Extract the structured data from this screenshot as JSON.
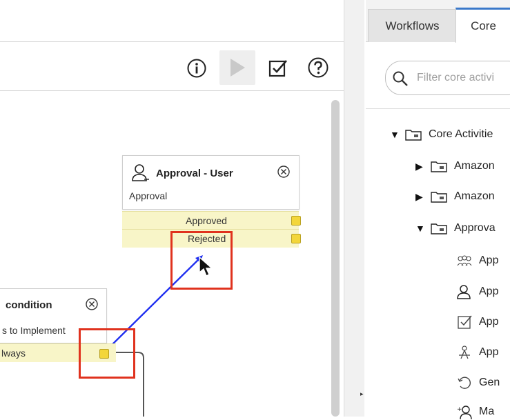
{
  "toolbar": {
    "info_icon": "info-icon",
    "run_icon": "play-icon",
    "validate_icon": "checkbox-icon",
    "help_icon": "help-icon"
  },
  "canvas": {
    "approval_activity": {
      "title": "Approval - User",
      "subtitle": "Approval",
      "exits": [
        "Approved",
        "Rejected"
      ]
    },
    "condition_activity": {
      "title": "condition",
      "subtitle": "s to Implement",
      "exit": "lways"
    }
  },
  "right_panel": {
    "tabs": [
      {
        "label": "Workflows",
        "active": false
      },
      {
        "label": "Core",
        "active": true
      }
    ],
    "search_placeholder": "Filter core activi",
    "tree": {
      "root": "Core Activitie",
      "folders": [
        {
          "label": "Amazon",
          "expanded": false
        },
        {
          "label": "Amazon",
          "expanded": false
        },
        {
          "label": "Approva",
          "expanded": true
        }
      ],
      "leaves": [
        {
          "label": "App",
          "icon": "group-approval-icon"
        },
        {
          "label": "App",
          "icon": "user-approval-icon"
        },
        {
          "label": "App",
          "icon": "approval-checkbox-icon"
        },
        {
          "label": "App",
          "icon": "approval-action-icon"
        },
        {
          "label": "Gen",
          "icon": "generate-icon"
        },
        {
          "label": "Ma",
          "icon": "manual-approval-icon"
        }
      ]
    }
  },
  "colors": {
    "accent_tab": "#3a78c9",
    "connector": "#1f2ff0",
    "highlight": "#e0321e",
    "exit_fill": "#f8f5c8",
    "port": "#f3d63a"
  }
}
